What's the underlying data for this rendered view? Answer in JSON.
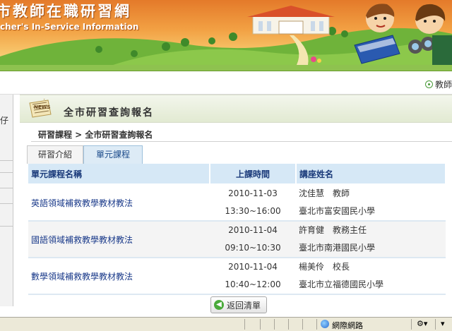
{
  "site": {
    "title": "市教師在職研習網",
    "subtitle": "cher's In-Service Information"
  },
  "toolbar": {
    "link": "教師"
  },
  "left": {
    "char": "仔"
  },
  "section": {
    "title": "全市研習查詢報名"
  },
  "breadcrumb": "研習課程 > 全市研習查詢報名",
  "tabs": [
    {
      "label": "研習介紹",
      "active": false
    },
    {
      "label": "單元課程",
      "active": true
    }
  ],
  "table": {
    "headers": [
      "單元課程名稱",
      "上課時間",
      "講座姓名"
    ],
    "rows": [
      {
        "course": "英語領域補救教學教材教法",
        "date": "2010-11-03",
        "time": "13:30~16:00",
        "lecturer": "沈佳慧　教師",
        "school": "臺北市富安國民小學"
      },
      {
        "course": "國語領域補救教學教材教法",
        "date": "2010-11-04",
        "time": "09:10~10:30",
        "lecturer": "許育健　教務主任",
        "school": "臺北市南港國民小學"
      },
      {
        "course": "數學領域補救教學教材教法",
        "date": "2010-11-04",
        "time": "10:40~12:00",
        "lecturer": "楊美伶　校長",
        "school": "臺北市立福德國民小學"
      }
    ]
  },
  "back_button": "返回清單",
  "statusbar": {
    "zone": "網際網路",
    "zoom": "▾"
  },
  "icons": {
    "news": "news-icon",
    "back": "back-arrow-icon",
    "globe": "globe-icon",
    "bullet": "circle-bullet-icon"
  }
}
